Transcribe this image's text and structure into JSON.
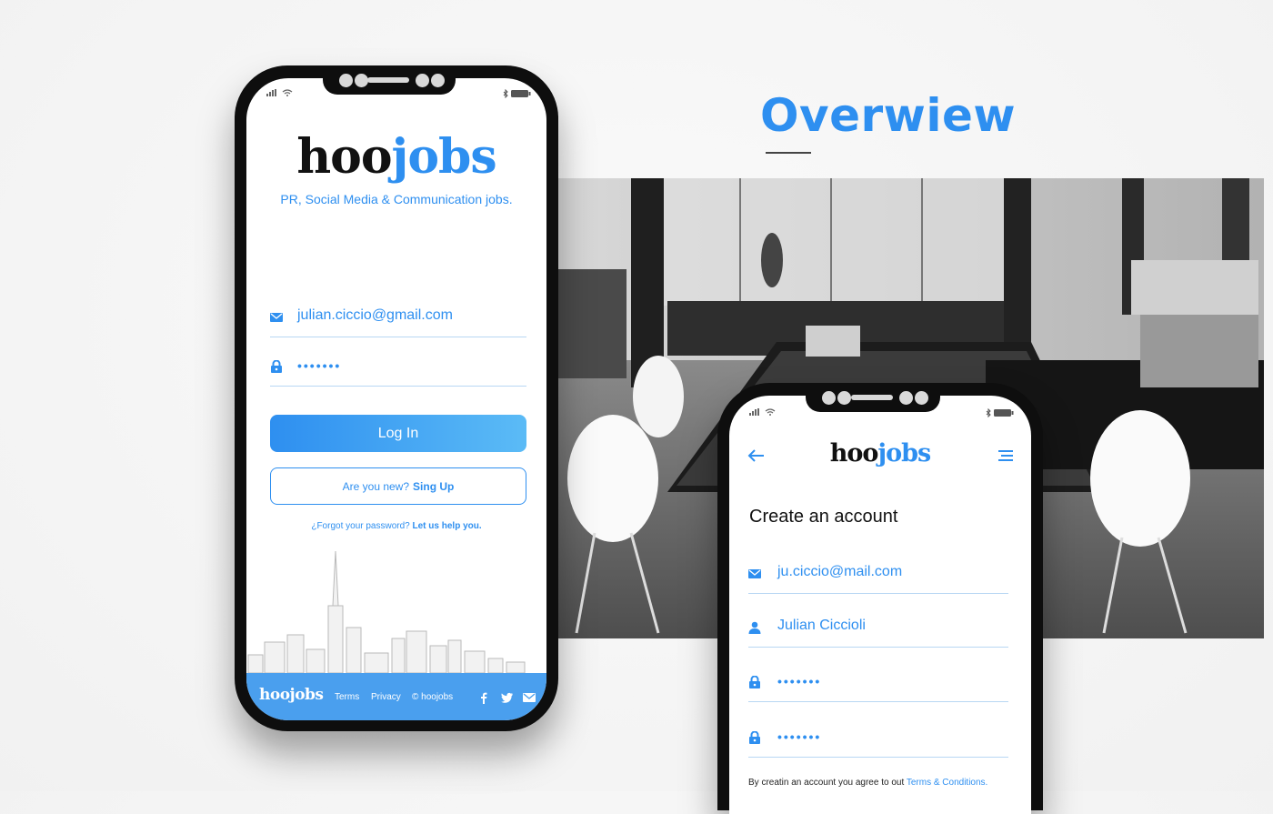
{
  "heading": {
    "title": "Overwiew"
  },
  "brand": {
    "part1": "hoo",
    "part2": "jobs",
    "footer_logo": "hoojobs"
  },
  "login_screen": {
    "tagline": "PR, Social Media & Communication jobs.",
    "email_value": "julian.ciccio@gmail.com",
    "password_value": "•••••••",
    "login_button": "Log In",
    "signup_prompt": "Are you new?",
    "signup_link": "Sing Up",
    "forgot_prompt": "¿Forgot your password?",
    "forgot_link": "Let us help you.",
    "footer": {
      "terms": "Terms",
      "privacy": "Privacy",
      "copyright": "© hoojobs"
    }
  },
  "signup_screen": {
    "title": "Create an account",
    "email_value": "ju.ciccio@mail.com",
    "name_value": "Julian Ciccioli",
    "password_value": "•••••••",
    "confirm_password_value": "•••••••",
    "terms_prefix": "By creatin an account you agree to out",
    "terms_link": "Terms & Conditions."
  },
  "icons": [
    "signal-icon",
    "wifi-icon",
    "bluetooth-icon",
    "battery-icon",
    "mail-icon",
    "lock-icon",
    "user-icon",
    "back-arrow-icon",
    "menu-icon",
    "facebook-icon",
    "twitter-icon"
  ],
  "colors": {
    "accent": "#2e8ff0",
    "footer_bg": "#4a9fee",
    "frame": "#0e0e0e"
  }
}
